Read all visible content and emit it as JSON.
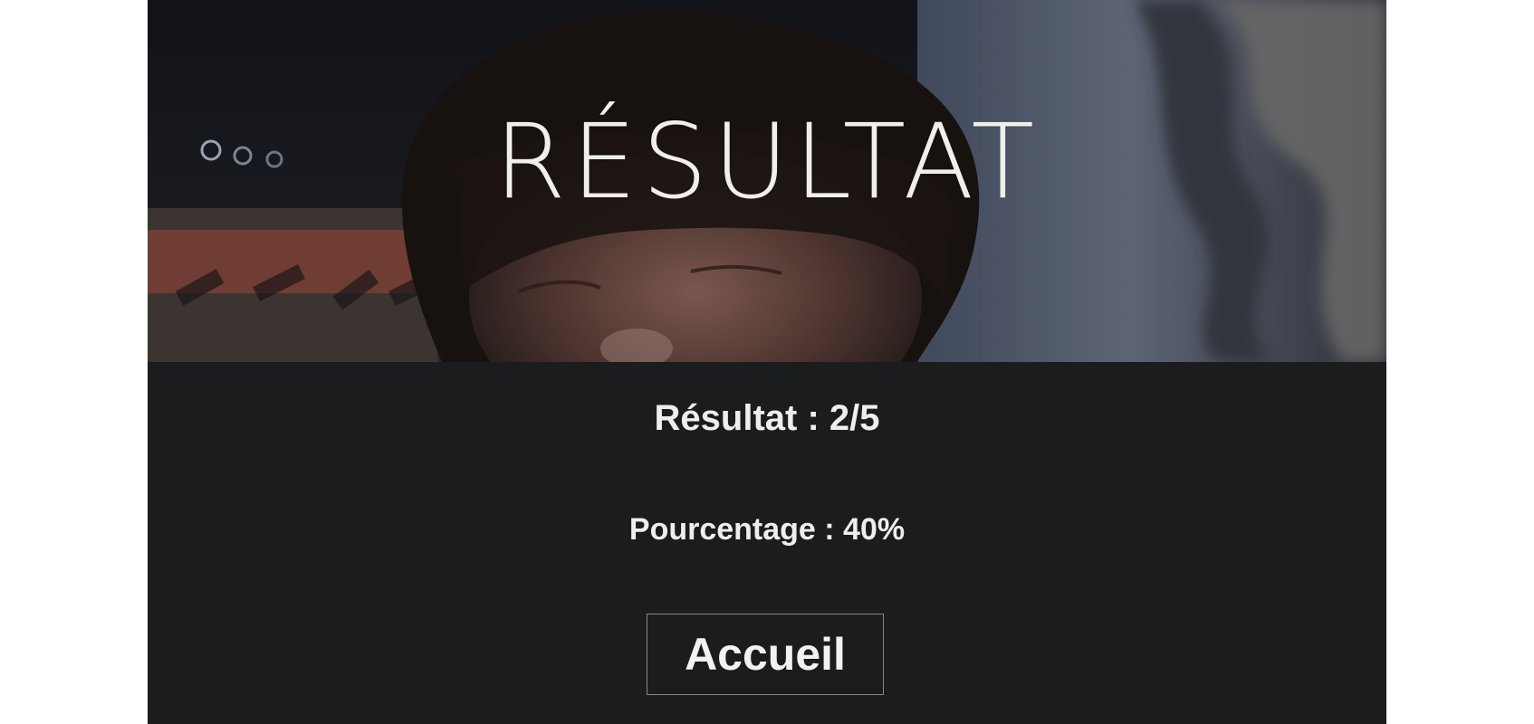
{
  "hero": {
    "title": "RÉSULTAT",
    "image": "blurred-crowd-and-smiling-face-photo"
  },
  "result": {
    "score_text": "Résultat : 2/5",
    "percentage_text": "Pourcentage : 40%"
  },
  "actions": {
    "home_label": "Accueil"
  },
  "colors": {
    "page_background": "#ffffff",
    "panel_background": "#1b1c1e",
    "text": "#eeeeee",
    "button_border": "#8a857b"
  }
}
